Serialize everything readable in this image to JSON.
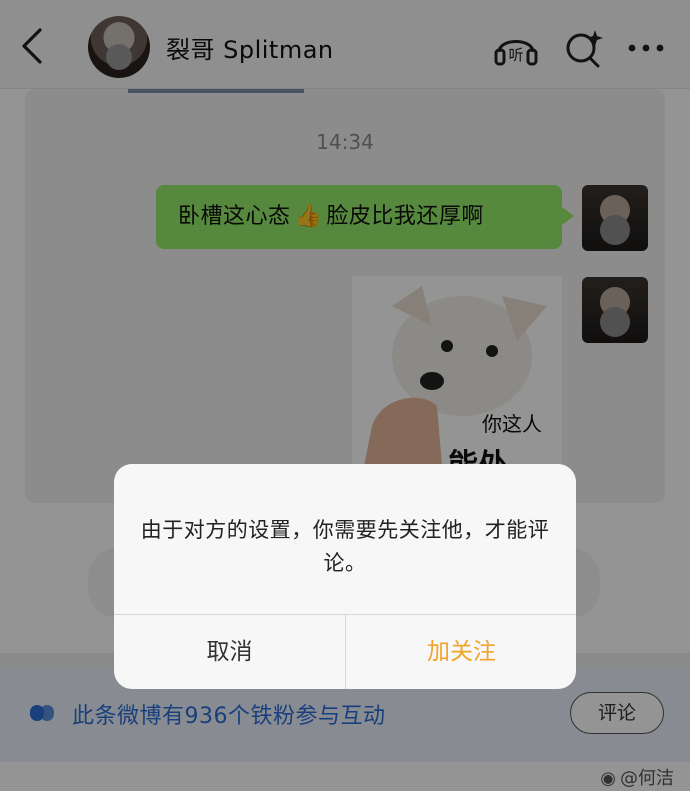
{
  "header": {
    "title": "裂哥 Splitman",
    "icons": [
      "back-arrow-icon",
      "listen-icon",
      "sparkle-search-icon",
      "more-icon"
    ],
    "listen_label": "听"
  },
  "chat": {
    "time": "14:34",
    "message_left": "卧槽这心态",
    "message_right": "脸皮比我还厚啊",
    "emoji": "👍",
    "sticker_line1": "你这人",
    "sticker_line2": "能处"
  },
  "footer": {
    "fans_text": "此条微博有936个铁粉参与互动",
    "comment_button": "评论",
    "watermark": "@何洁"
  },
  "dialog": {
    "message": "由于对方的设置，你需要先关注他，才能评论。",
    "cancel": "取消",
    "follow": "加关注"
  },
  "colors": {
    "bubble_green": "#95ec69",
    "follow_accent": "#f0a42b",
    "link_blue": "#2b6ed6"
  }
}
